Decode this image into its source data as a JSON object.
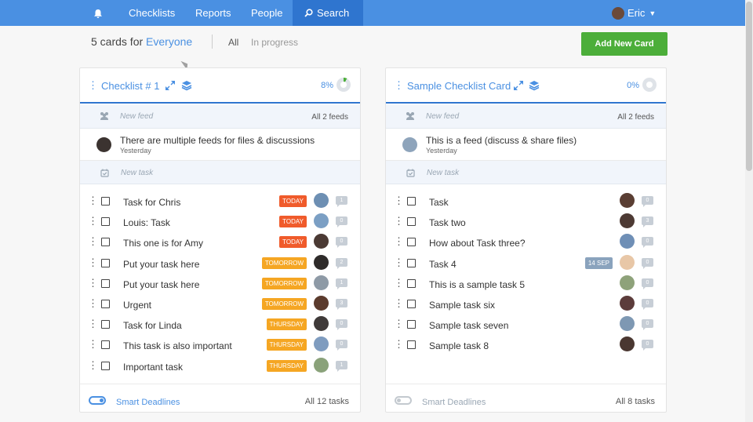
{
  "nav": {
    "items": [
      {
        "label": "Checklists"
      },
      {
        "label": "Reports"
      },
      {
        "label": "People"
      },
      {
        "label": "Search"
      }
    ],
    "user": "Eric"
  },
  "header": {
    "count_prefix": "5 cards for",
    "count_scope": "Everyone",
    "filter_all": "All",
    "filter_progress": "In progress",
    "add_card": "Add New Card"
  },
  "colors": {
    "brand": "#4a90e2",
    "nav_active": "#2f75cf",
    "add_button": "#4cae3a",
    "badge_today": "#f05b2b",
    "badge_later": "#f5a623",
    "badge_date": "#8aa3bd"
  },
  "cards": [
    {
      "title": "Checklist # 1",
      "percent": "8%",
      "progress": 0.08,
      "feed_placeholder": "New feed",
      "feed_count": "All 2 feeds",
      "feed_message": "There are multiple feeds for files & discussions",
      "feed_date": "Yesterday",
      "task_placeholder": "New task",
      "smart_label": "Smart Deadlines",
      "smart_on": true,
      "task_count": "All 12 tasks",
      "tasks": [
        {
          "name": "Task for Chris",
          "badge": "TODAY",
          "badge_type": "today",
          "comments": "1",
          "avatar": "#6d8fb3"
        },
        {
          "name": "Louis: Task",
          "badge": "TODAY",
          "badge_type": "today",
          "comments": "0",
          "avatar": "#7b9fc4"
        },
        {
          "name": "This one is for Amy",
          "badge": "TODAY",
          "badge_type": "today",
          "comments": "0",
          "avatar": "#4b3a34"
        },
        {
          "name": "Put your task here",
          "badge": "TOMORROW",
          "badge_type": "later",
          "comments": "2",
          "avatar": "#2e2b2a"
        },
        {
          "name": "Put your task here",
          "badge": "TOMORROW",
          "badge_type": "later",
          "comments": "1",
          "avatar": "#8e9aa6"
        },
        {
          "name": "Urgent",
          "badge": "TOMORROW",
          "badge_type": "later",
          "comments": "3",
          "avatar": "#5b3b2d"
        },
        {
          "name": "Task for Linda",
          "badge": "THURSDAY",
          "badge_type": "later",
          "comments": "0",
          "avatar": "#3f3a39"
        },
        {
          "name": "This task is also important",
          "badge": "THURSDAY",
          "badge_type": "later",
          "comments": "0",
          "avatar": "#7f9cbf"
        },
        {
          "name": "Important task",
          "badge": "THURSDAY",
          "badge_type": "later",
          "comments": "1",
          "avatar": "#8aa27a"
        }
      ]
    },
    {
      "title": "Sample Checklist Card",
      "percent": "0%",
      "progress": 0,
      "feed_placeholder": "New feed",
      "feed_count": "All 2 feeds",
      "feed_message": "This is a feed (discuss & share files)",
      "feed_date": "Yesterday",
      "task_placeholder": "New task",
      "smart_label": "Smart Deadlines",
      "smart_on": false,
      "task_count": "All 8 tasks",
      "tasks": [
        {
          "name": "Task",
          "badge": "",
          "badge_type": "",
          "comments": "0",
          "avatar": "#5a3e33"
        },
        {
          "name": "Task two",
          "badge": "",
          "badge_type": "",
          "comments": "3",
          "avatar": "#4d3a34"
        },
        {
          "name": "How about Task three?",
          "badge": "",
          "badge_type": "",
          "comments": "0",
          "avatar": "#6f8fb6"
        },
        {
          "name": "Task 4",
          "badge": "14 SEP",
          "badge_type": "date",
          "comments": "0",
          "avatar": "#e8c7a7"
        },
        {
          "name": "This is a sample task 5",
          "badge": "",
          "badge_type": "",
          "comments": "0",
          "avatar": "#8ea27a"
        },
        {
          "name": "Sample task six",
          "badge": "",
          "badge_type": "",
          "comments": "0",
          "avatar": "#5c3c3b"
        },
        {
          "name": "Sample task seven",
          "badge": "",
          "badge_type": "",
          "comments": "0",
          "avatar": "#7e98b3"
        },
        {
          "name": "Sample task 8",
          "badge": "",
          "badge_type": "",
          "comments": "0",
          "avatar": "#4a3731"
        }
      ]
    }
  ]
}
